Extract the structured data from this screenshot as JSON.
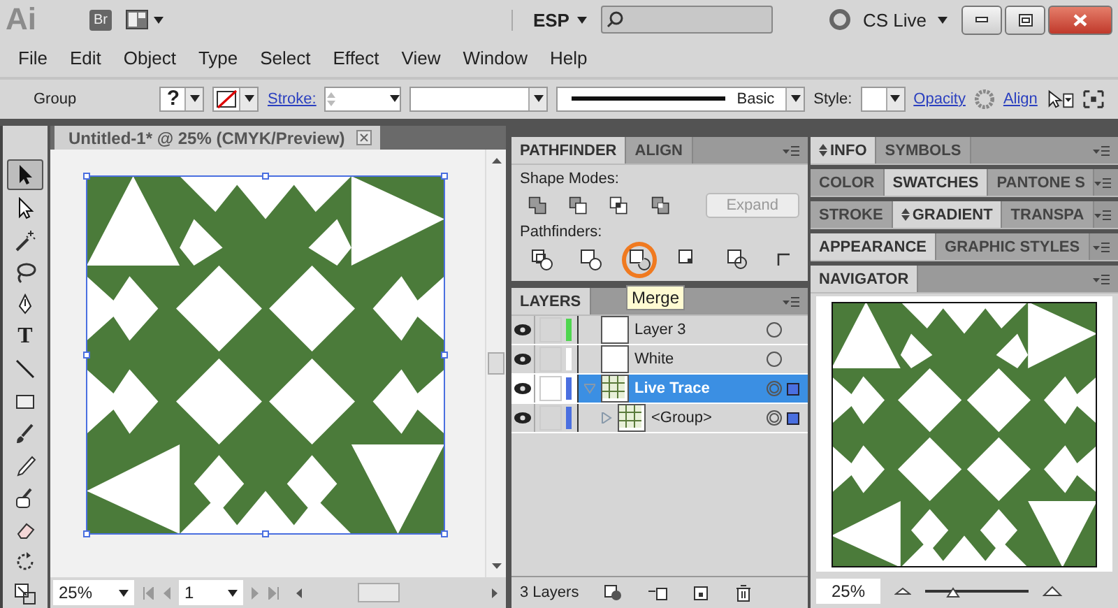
{
  "title_bar": {
    "logo": "Ai",
    "bridge": "Br",
    "workspace": "ESP",
    "cs_live": "CS Live"
  },
  "menu": [
    "File",
    "Edit",
    "Object",
    "Type",
    "Select",
    "Effect",
    "View",
    "Window",
    "Help"
  ],
  "control_bar": {
    "selection": "Group",
    "fill": "?",
    "stroke_link": "Stroke:",
    "brush": "Basic",
    "style_label": "Style:",
    "opacity_link": "Opacity",
    "align_link": "Align"
  },
  "tools": [
    {
      "kind": "selection",
      "selected": true
    },
    {
      "kind": "direct-selection",
      "selected": false
    },
    {
      "kind": "magic-wand",
      "selected": false
    },
    {
      "kind": "lasso",
      "selected": false
    },
    {
      "kind": "pen",
      "selected": false
    },
    {
      "kind": "type",
      "selected": false,
      "glyph": "T"
    },
    {
      "kind": "line",
      "selected": false
    },
    {
      "kind": "rectangle",
      "selected": false
    },
    {
      "kind": "paintbrush",
      "selected": false
    },
    {
      "kind": "pencil",
      "selected": false
    },
    {
      "kind": "blob-brush",
      "selected": false
    },
    {
      "kind": "eraser",
      "selected": false
    },
    {
      "kind": "rotate",
      "selected": false
    },
    {
      "kind": "scale",
      "selected": false
    }
  ],
  "document": {
    "tab": "Untitled-1* @ 25% (CMYK/Preview)",
    "zoom": "25%",
    "page": "1"
  },
  "pathfinder_panel": {
    "tabs": [
      {
        "label": "PATHFINDER",
        "selected": true
      },
      {
        "label": "ALIGN",
        "selected": false
      }
    ],
    "shape_modes_label": "Shape Modes:",
    "shape_modes": [
      {
        "kind": "unite"
      },
      {
        "kind": "minus-front"
      },
      {
        "kind": "intersect"
      },
      {
        "kind": "exclude"
      }
    ],
    "expand_button": "Expand",
    "expand_disabled": true,
    "pathfinders_label": "Pathfinders:",
    "pathfinders": [
      {
        "kind": "divide",
        "highlighted": false
      },
      {
        "kind": "trim",
        "highlighted": false
      },
      {
        "kind": "merge",
        "highlighted": true
      },
      {
        "kind": "crop",
        "highlighted": false
      },
      {
        "kind": "outline",
        "highlighted": false
      },
      {
        "kind": "minus-back",
        "highlighted": false
      }
    ],
    "tooltip": "Merge"
  },
  "layers_panel": {
    "tab": "LAYERS",
    "layers": [
      {
        "kind": "empty",
        "name": "Layer 3",
        "color": "#4fd64f",
        "visible": true,
        "selected": false,
        "has_selection": false
      },
      {
        "kind": "empty",
        "name": "White",
        "color": "#ffffff",
        "visible": true,
        "selected": false,
        "has_selection": false
      },
      {
        "kind": "artwork",
        "name": "Live Trace",
        "color": "#4a6fe0",
        "visible": true,
        "selected": true,
        "expanded": true,
        "has_selection": true,
        "children": [
          {
            "kind": "artwork",
            "name": "<Group>",
            "color": "#4a6fe0",
            "visible": true,
            "selected": false,
            "expanded": false,
            "has_selection": true
          }
        ]
      }
    ],
    "count": "3 Layers"
  },
  "panel_groups": [
    {
      "tabs": [
        {
          "label": "INFO",
          "selected": true,
          "arrows": true
        },
        {
          "label": "SYMBOLS",
          "selected": false,
          "arrows": false
        }
      ]
    },
    {
      "tabs": [
        {
          "label": "COLOR",
          "selected": false,
          "arrows": false
        },
        {
          "label": "SWATCHES",
          "selected": true,
          "arrows": false
        },
        {
          "label": "PANTONE S",
          "selected": false,
          "arrows": false
        }
      ]
    },
    {
      "tabs": [
        {
          "label": "STROKE",
          "selected": false,
          "arrows": false
        },
        {
          "label": "GRADIENT",
          "selected": true,
          "arrows": true
        },
        {
          "label": "TRANSPA",
          "selected": false,
          "arrows": false
        }
      ]
    },
    {
      "tabs": [
        {
          "label": "APPEARANCE",
          "selected": true,
          "arrows": false
        },
        {
          "label": "GRAPHIC STYLES",
          "selected": false,
          "arrows": false
        }
      ]
    },
    {
      "tabs": [
        {
          "label": "NAVIGATOR",
          "selected": true,
          "arrows": false
        }
      ]
    }
  ],
  "navigator": {
    "zoom": "25%",
    "level": 0.27
  }
}
